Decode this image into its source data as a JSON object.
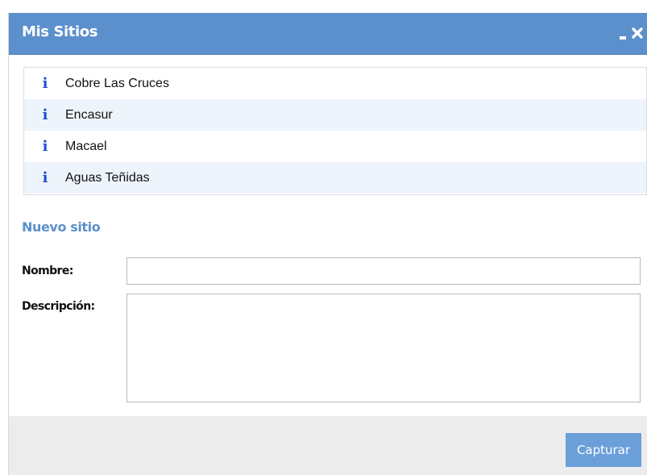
{
  "window": {
    "title": "Mis Sitios"
  },
  "sites": [
    {
      "label": "Cobre Las Cruces",
      "icon": "info-icon"
    },
    {
      "label": "Encasur",
      "icon": "info-icon"
    },
    {
      "label": "Macael",
      "icon": "info-icon"
    },
    {
      "label": "Aguas Teñidas",
      "icon": "info-icon"
    }
  ],
  "form": {
    "section_title": "Nuevo sitio",
    "name_label": "Nombre:",
    "name_value": "",
    "description_label": "Descripción:",
    "description_value": ""
  },
  "footer": {
    "capture_label": "Capturar"
  },
  "colors": {
    "header": "#5b90cc",
    "accent_text": "#5b90cc",
    "button": "#6a9fd9",
    "info_icon": "#1b4fd6",
    "alt_row": "#eef4fb",
    "footer": "#ececec"
  }
}
